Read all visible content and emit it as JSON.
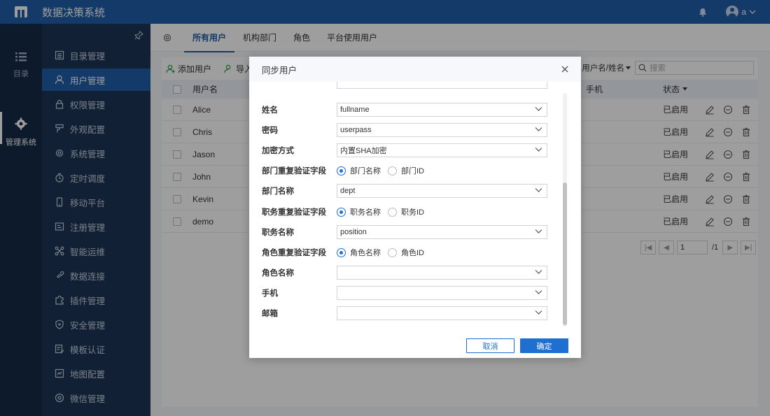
{
  "app": {
    "title": "数据决策系统",
    "user": "a"
  },
  "rail": [
    {
      "label": "目录",
      "icon": "list-icon"
    },
    {
      "label": "管理系统",
      "icon": "gear-icon"
    }
  ],
  "sidebar": {
    "items": [
      {
        "label": "目录管理",
        "icon": "catalog-icon"
      },
      {
        "label": "用户管理",
        "icon": "user-icon"
      },
      {
        "label": "权限管理",
        "icon": "lock-icon"
      },
      {
        "label": "外观配置",
        "icon": "paint-icon"
      },
      {
        "label": "系统管理",
        "icon": "gear-icon"
      },
      {
        "label": "定时调度",
        "icon": "clock-icon"
      },
      {
        "label": "移动平台",
        "icon": "mobile-icon"
      },
      {
        "label": "注册管理",
        "icon": "register-icon"
      },
      {
        "label": "智能运维",
        "icon": "ops-icon"
      },
      {
        "label": "数据连接",
        "icon": "link-icon"
      },
      {
        "label": "插件管理",
        "icon": "plugin-icon"
      },
      {
        "label": "安全管理",
        "icon": "shield-icon"
      },
      {
        "label": "模板认证",
        "icon": "template-icon"
      },
      {
        "label": "地图配置",
        "icon": "map-icon"
      },
      {
        "label": "微信管理",
        "icon": "wechat-icon"
      }
    ]
  },
  "tabs": [
    "所有用户",
    "机构部门",
    "角色",
    "平台使用用户"
  ],
  "toolbar": {
    "add_user": "添加用户",
    "import_user": "导入用户"
  },
  "search": {
    "type": "用户名/姓名",
    "placeholder": "搜索"
  },
  "table": {
    "headers": {
      "name": "用户名",
      "phone": "手机",
      "status": "状态"
    },
    "rows": [
      {
        "name": "Alice",
        "status": "已启用"
      },
      {
        "name": "Chris",
        "status": "已启用"
      },
      {
        "name": "Jason",
        "status": "已启用"
      },
      {
        "name": "John",
        "status": "已启用"
      },
      {
        "name": "Kevin",
        "status": "已启用"
      },
      {
        "name": "demo",
        "status": "已启用"
      }
    ]
  },
  "pager": {
    "page": "1",
    "total": "/1"
  },
  "dialog": {
    "title": "同步用户",
    "fields": {
      "fullname": {
        "label": "姓名",
        "value": "fullname"
      },
      "password": {
        "label": "密码",
        "value": "userpass"
      },
      "encrypt": {
        "label": "加密方式",
        "value": "内置SHA加密"
      },
      "dept_verify": {
        "label": "部门重复验证字段",
        "opt1": "部门名称",
        "opt2": "部门ID"
      },
      "dept_name": {
        "label": "部门名称",
        "value": "dept"
      },
      "post_verify": {
        "label": "职务重复验证字段",
        "opt1": "职务名称",
        "opt2": "职务ID"
      },
      "post_name": {
        "label": "职务名称",
        "value": "position"
      },
      "role_verify": {
        "label": "角色重复验证字段",
        "opt1": "角色名称",
        "opt2": "角色ID"
      },
      "role_name": {
        "label": "角色名称",
        "value": ""
      },
      "mobile": {
        "label": "手机",
        "value": ""
      },
      "email": {
        "label": "邮箱",
        "value": ""
      }
    },
    "cancel": "取消",
    "ok": "确定"
  },
  "colors": {
    "primary": "#1f5ea8",
    "accent": "#1f6fd0",
    "sidebar": "#1c3556",
    "rail": "#152b47"
  }
}
